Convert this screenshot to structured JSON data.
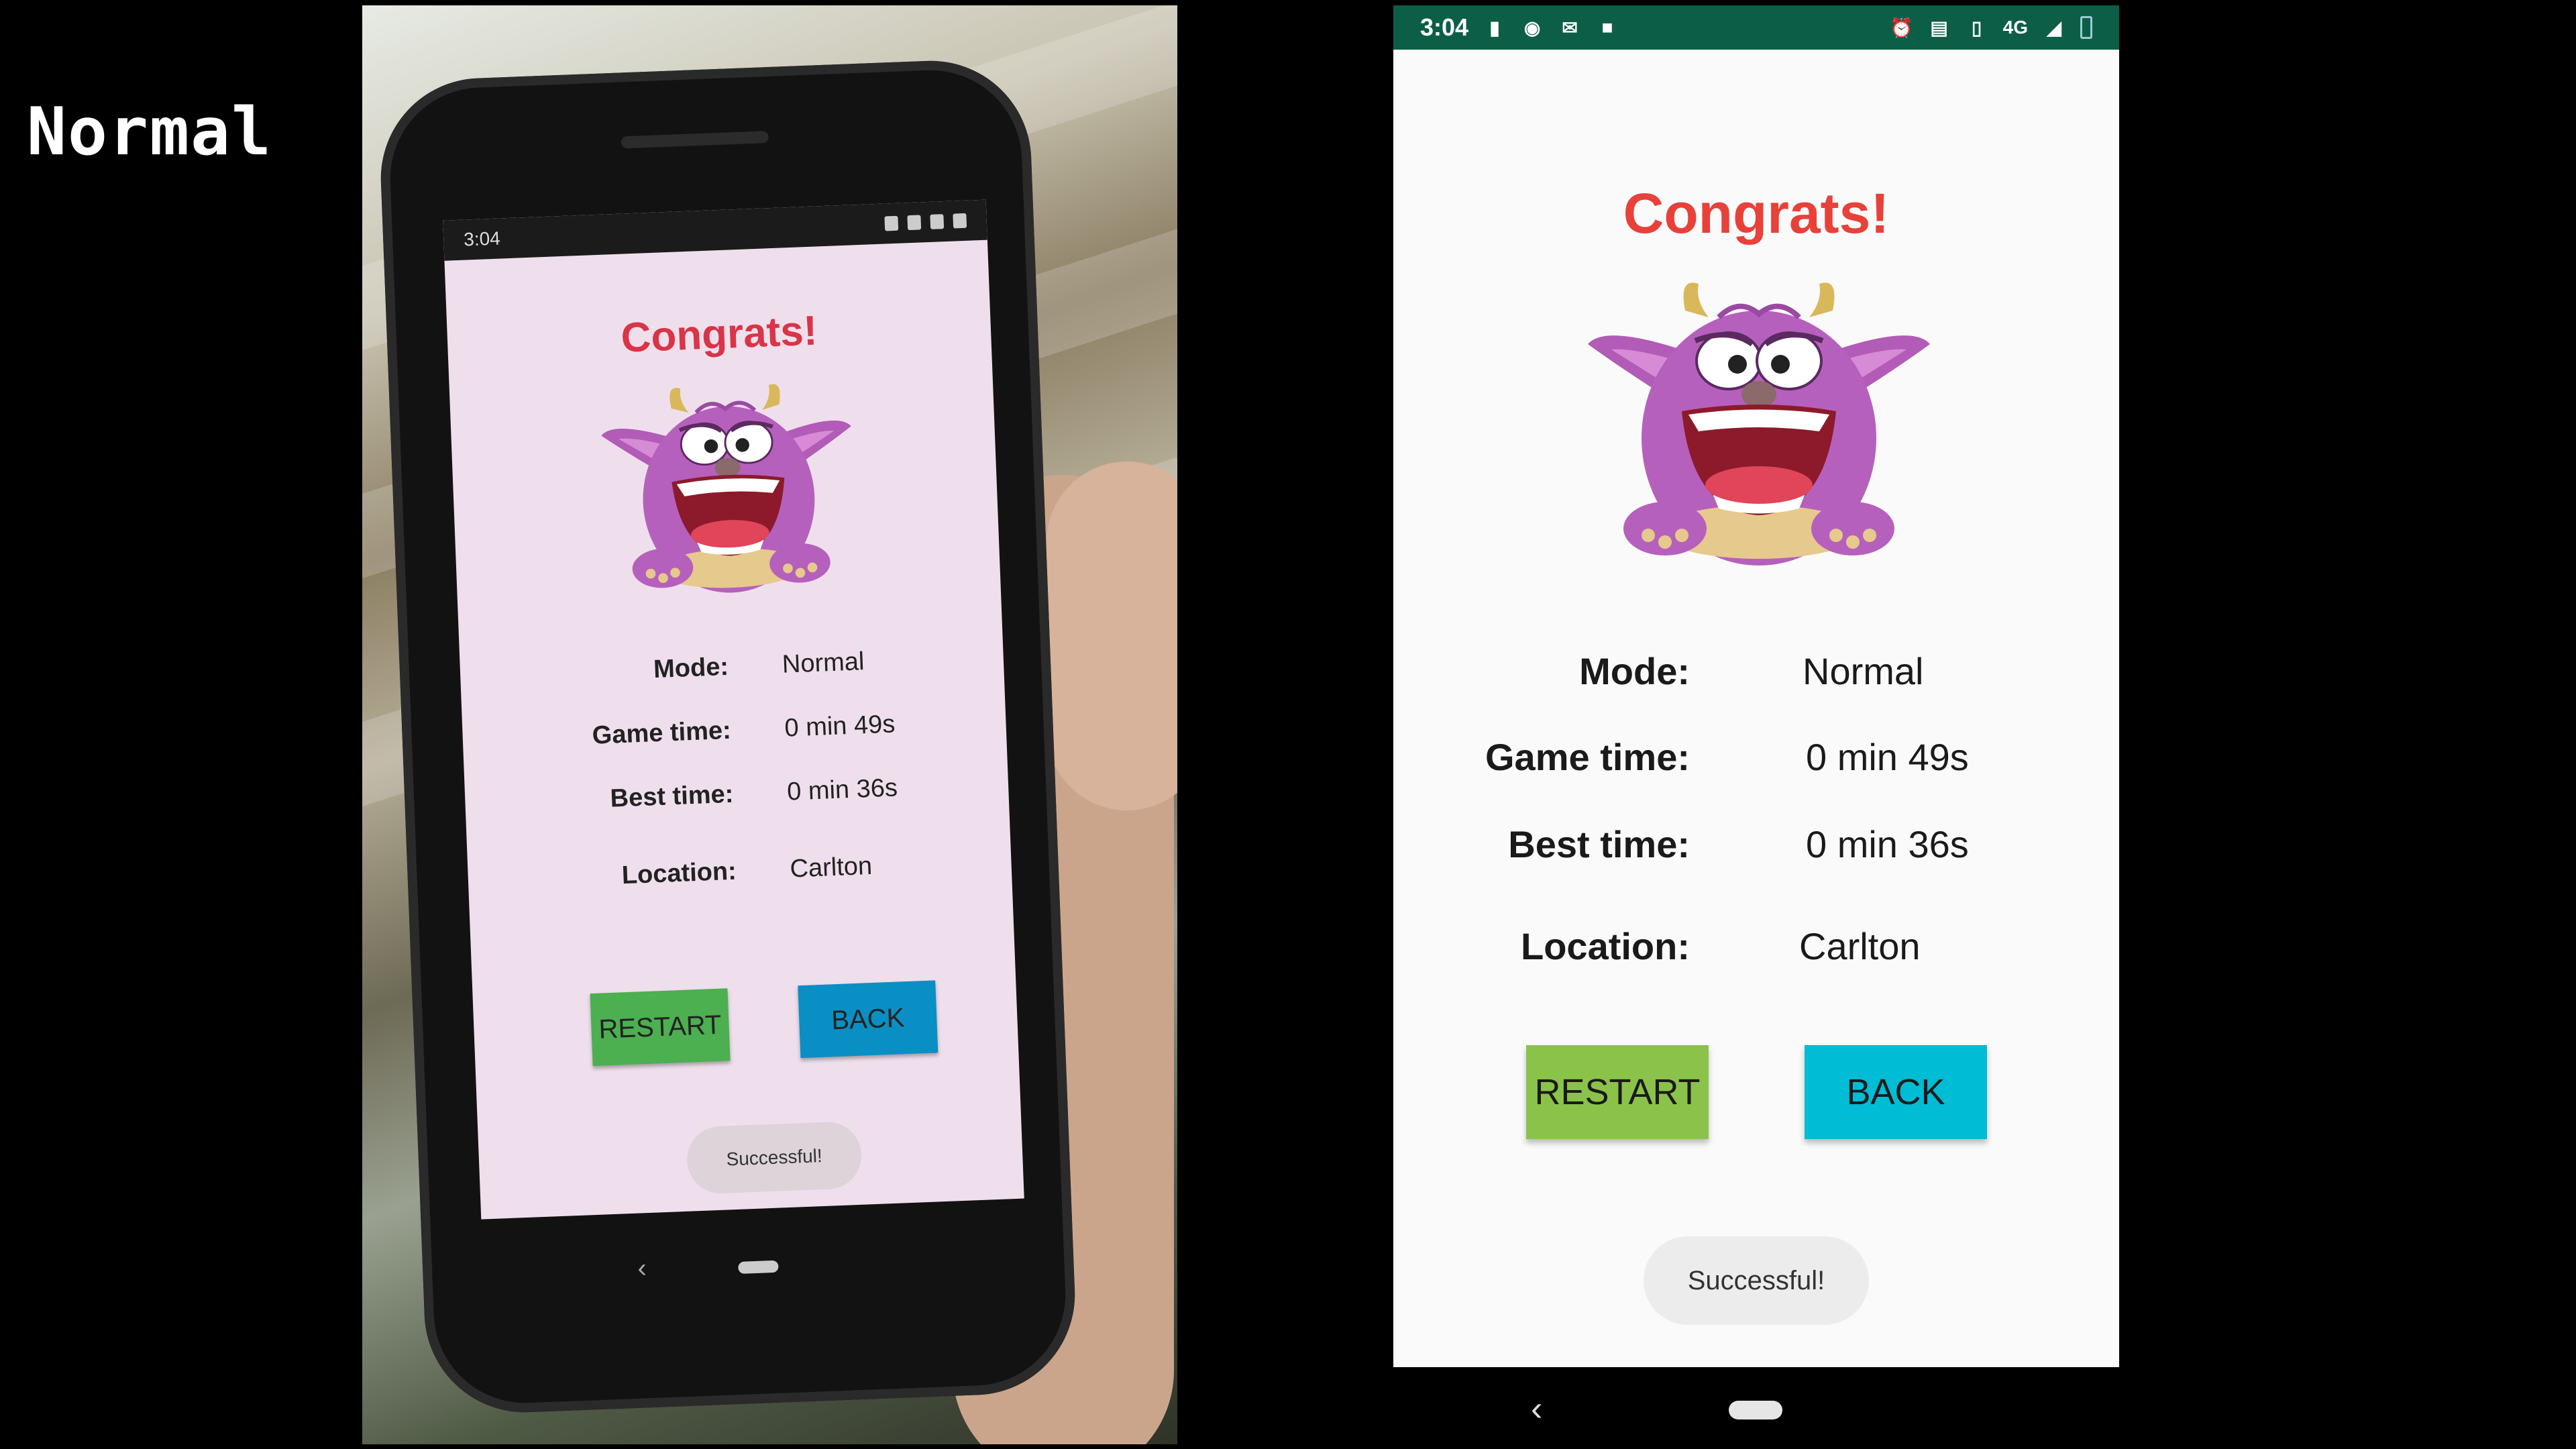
{
  "mode_tag": "Normal",
  "status_bar": {
    "time": "3:04",
    "network": "4G"
  },
  "screen": {
    "title": "Congrats!",
    "stats": [
      {
        "label": "Mode:",
        "value": "Normal"
      },
      {
        "label": "Game time:",
        "value": "0 min 49s"
      },
      {
        "label": "Best time:",
        "value": "0 min 36s"
      },
      {
        "label": "Location:",
        "value": "Carlton"
      }
    ],
    "restart_label": "RESTART",
    "back_label": "BACK",
    "toast": "Successful!"
  },
  "nav": {
    "back_glyph": "‹"
  },
  "colors": {
    "title": "#e8413a",
    "restart_button": "#8bc34a",
    "back_button": "#00bcd4",
    "status_bar": "#0d5e47"
  },
  "icons": [
    "battery-alert-icon",
    "circle-app-icon",
    "gmail-icon",
    "video-icon",
    "alarm-icon",
    "cast-icon",
    "vibrate-icon",
    "signal-icon",
    "battery-icon",
    "monster-image"
  ]
}
